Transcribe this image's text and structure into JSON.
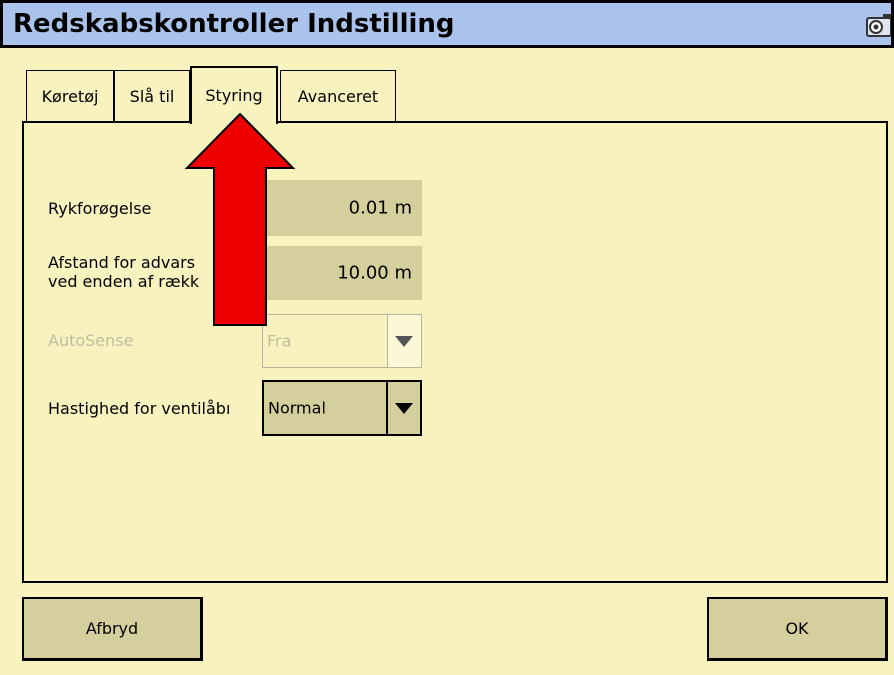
{
  "window": {
    "title": "Redskabskontroller Indstilling",
    "camera_icon": "camera-icon"
  },
  "tabs": [
    {
      "label": "Køretøj",
      "active": false
    },
    {
      "label": "Slå til",
      "active": false
    },
    {
      "label": "Styring",
      "active": true
    },
    {
      "label": "Avanceret",
      "active": false
    }
  ],
  "settings": {
    "ryk_label": "Rykforøgelse",
    "ryk_value": "0.01 m",
    "afstand_label_line1": "Afstand for advars",
    "afstand_label_line2": "ved enden af rækk",
    "afstand_value": "10.00 m",
    "autosense_label": "AutoSense",
    "autosense_value": "Fra",
    "hastighed_label": "Hastighed for ventilåbı",
    "hastighed_value": "Normal"
  },
  "buttons": {
    "cancel": "Afbryd",
    "ok": "OK"
  },
  "colors": {
    "background": "#f8f3be",
    "titlebar": "#a9c3ec",
    "field": "#d4cf9c",
    "annotation_arrow": "#ee0000"
  }
}
